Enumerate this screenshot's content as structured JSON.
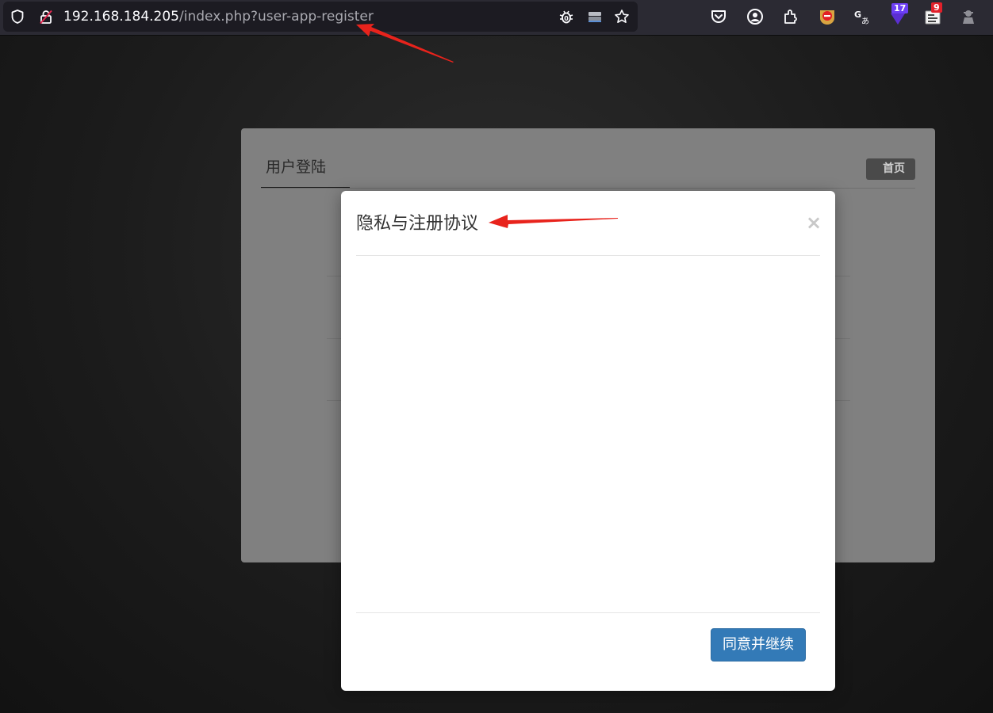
{
  "browser": {
    "url_host": "192.168.184.205",
    "url_path": "/index.php?user-app-register",
    "badges": {
      "extension_purple": "17",
      "extension_red": "9"
    },
    "colors": {
      "toolbar": "#2b2a33",
      "urlbar": "#1c1b22",
      "badge_purple": "#6d3ff5",
      "badge_red": "#e2202a"
    },
    "icons": [
      "shield-icon",
      "insecure-lock-icon",
      "bug-icon",
      "server-icon",
      "bookmark-star-icon",
      "pocket-icon",
      "account-icon",
      "extensions-icon",
      "ublock-icon",
      "translate-icon",
      "extension-purple-icon",
      "extension-red-icon",
      "spy-icon"
    ]
  },
  "page": {
    "tab_label": "用户登陆",
    "home_button": "首页"
  },
  "modal": {
    "title": "隐私与注册协议",
    "close_symbol": "×",
    "agree_button": "同意并继续",
    "colors": {
      "primary": "#337ab7"
    }
  },
  "annotations": {
    "arrow_color": "#e8231c"
  }
}
